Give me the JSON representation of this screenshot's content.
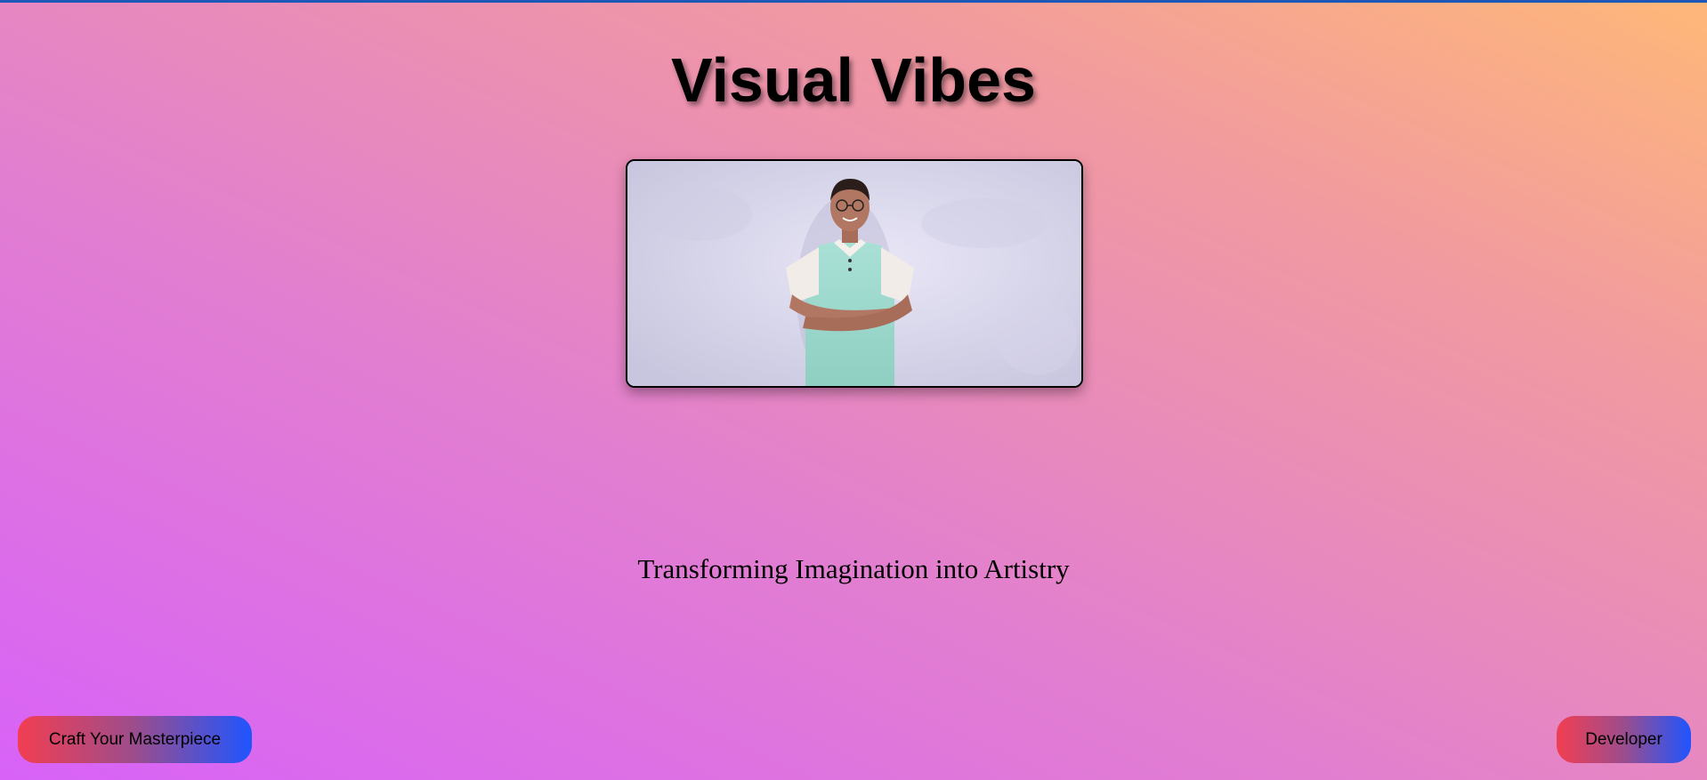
{
  "header": {
    "title": "Visual Vibes"
  },
  "hero": {
    "image_alt": "Developer photo",
    "tagline": "Transforming Imagination into Artistry"
  },
  "actions": {
    "craft_label": "Craft Your Masterpiece",
    "developer_label": "Developer"
  },
  "colors": {
    "bg_start": "#d862f8",
    "bg_end": "#ffb878",
    "button_gradient_start": "#f23e52",
    "button_gradient_end": "#1f55ff",
    "top_border": "#1d57b8"
  }
}
